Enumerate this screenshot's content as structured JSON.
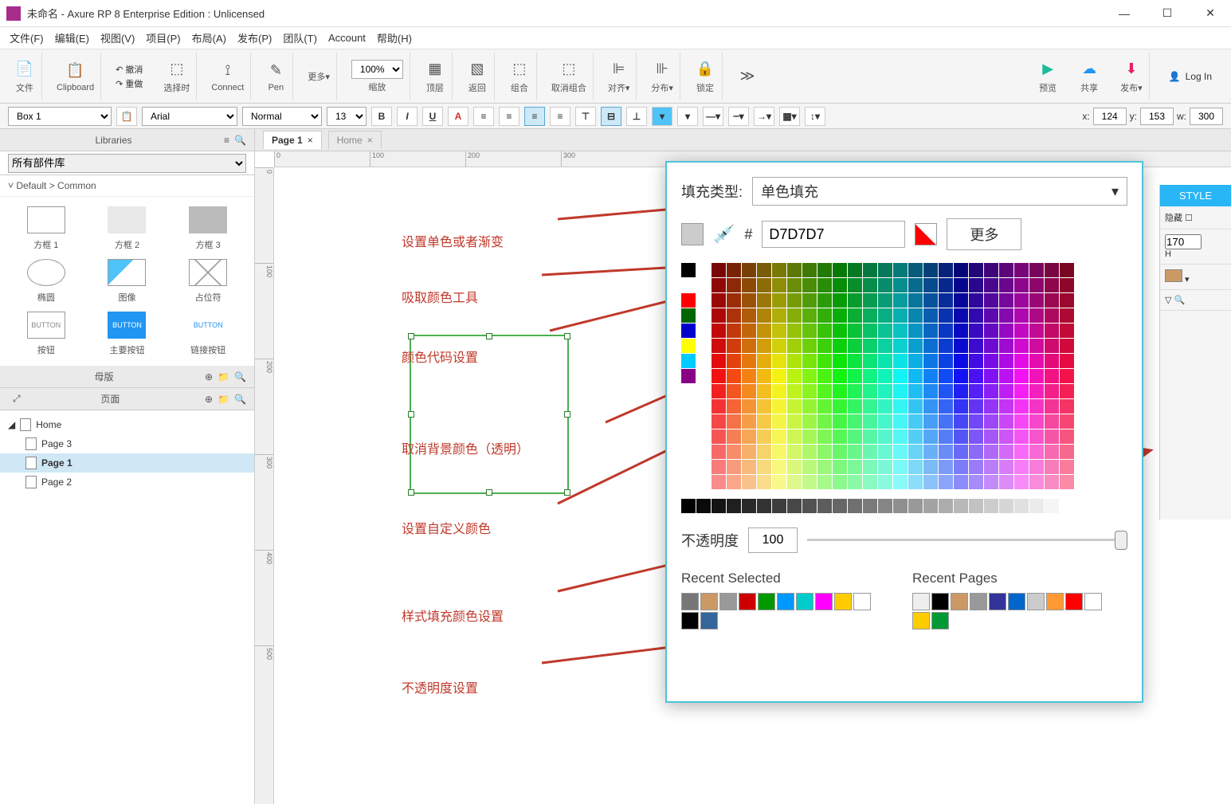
{
  "window": {
    "title": "未命名 - Axure RP 8 Enterprise Edition : Unlicensed"
  },
  "menu": [
    "文件(F)",
    "编辑(E)",
    "视图(V)",
    "项目(P)",
    "布局(A)",
    "发布(P)",
    "团队(T)",
    "Account",
    "帮助(H)"
  ],
  "toolbar": {
    "groups": [
      {
        "label": "文件"
      },
      {
        "label": "Clipboard"
      },
      {
        "undo": "撤消",
        "redo": "重做"
      },
      {
        "label": "选择时"
      },
      {
        "label": "Connect"
      },
      {
        "label": "Pen"
      },
      {
        "label": "更多▾"
      },
      {
        "label": "缩放",
        "zoom": "100%"
      },
      {
        "label": "顶层"
      },
      {
        "label": "返回"
      },
      {
        "label": "组合"
      },
      {
        "label": "取消组合"
      },
      {
        "label": "对齐▾"
      },
      {
        "label": "分布▾"
      },
      {
        "label": "锁定"
      },
      {
        "label": "预览"
      },
      {
        "label": "共享"
      },
      {
        "label": "发布▾"
      }
    ],
    "login": "Log In"
  },
  "format": {
    "shape": "Box 1",
    "font": "Arial",
    "weight": "Normal",
    "size": "13",
    "x": "124",
    "y": "153",
    "w": "300"
  },
  "left": {
    "libraries_title": "Libraries",
    "lib_select": "所有部件库",
    "section": "Default > Common",
    "widgets": [
      {
        "label": "方框 1",
        "type": "rect"
      },
      {
        "label": "方框 2",
        "type": "filled"
      },
      {
        "label": "方框 3",
        "type": "dark"
      },
      {
        "label": "椭圆",
        "type": "ellipse"
      },
      {
        "label": "图像",
        "type": "img"
      },
      {
        "label": "占位符",
        "type": "placeholder"
      },
      {
        "label": "按钮",
        "type": "button",
        "text": "BUTTON"
      },
      {
        "label": "主要按钮",
        "type": "primary",
        "text": "BUTTON"
      },
      {
        "label": "链接按钮",
        "type": "link",
        "text": "BUTTON"
      }
    ],
    "masters_title": "母版",
    "pages_title": "页面",
    "tree": [
      {
        "label": "Home",
        "level": 0
      },
      {
        "label": "Page 3",
        "level": 1
      },
      {
        "label": "Page 1",
        "level": 1,
        "selected": true
      },
      {
        "label": "Page 2",
        "level": 1
      }
    ]
  },
  "canvas": {
    "tabs": [
      {
        "label": "Page 1",
        "active": true
      },
      {
        "label": "Home",
        "active": false
      }
    ],
    "ruler_h": [
      "0",
      "100",
      "200",
      "300"
    ],
    "ruler_v": [
      "0",
      "100",
      "200",
      "300",
      "400",
      "500"
    ]
  },
  "annotations": [
    "设置单色或者渐变",
    "吸取颜色工具",
    "颜色代码设置",
    "取消背景颜色（透明）",
    "设置自定义颜色",
    "样式填充颜色设置",
    "不透明度设置"
  ],
  "popup": {
    "fill_type_label": "填充类型:",
    "fill_type_value": "单色填充",
    "hash": "#",
    "hex": "D7D7D7",
    "more": "更多",
    "opacity_label": "不透明度",
    "opacity_value": "100",
    "recent_selected": "Recent Selected",
    "recent_pages": "Recent Pages"
  },
  "right": {
    "style": "STYLE",
    "hidden": "隐藏",
    "h_value": "170",
    "h_label": "H"
  }
}
